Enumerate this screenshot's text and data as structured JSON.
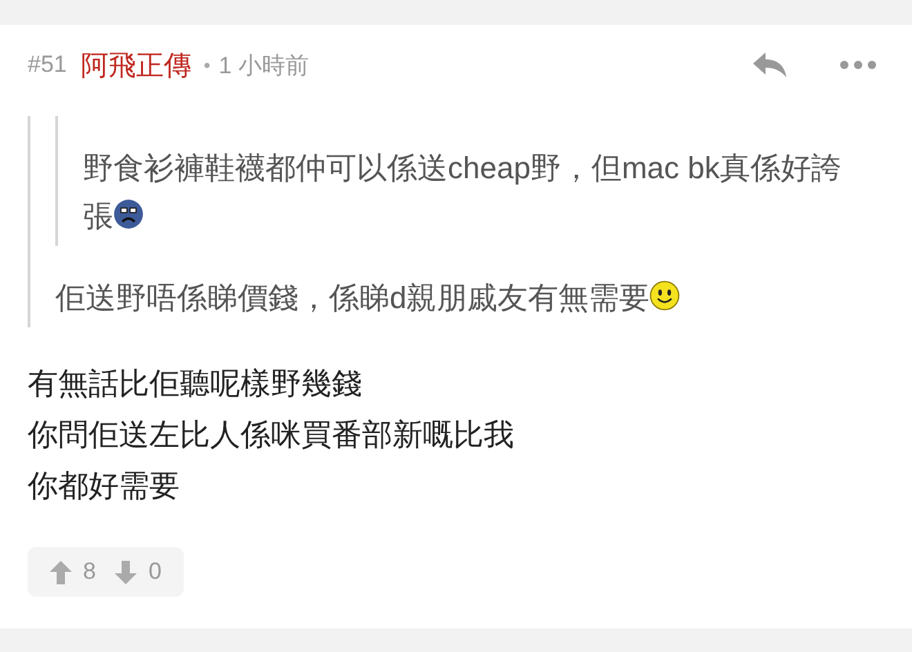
{
  "post": {
    "number": "#51",
    "author": "阿飛正傳",
    "separator": "•",
    "time": "1 小時前"
  },
  "quote": {
    "quote": {
      "text": "野食衫褲鞋襪都仲可以係送cheap野，但mac bk真係好誇張"
    },
    "text": "佢送野唔係睇價錢，係睇d親朋戚友有無需要"
  },
  "body": [
    "有無話比佢聽呢樣野幾錢",
    "你問佢送左比人係咪買番部新嘅比我",
    "你都好需要"
  ],
  "votes": {
    "up": "8",
    "down": "0"
  }
}
